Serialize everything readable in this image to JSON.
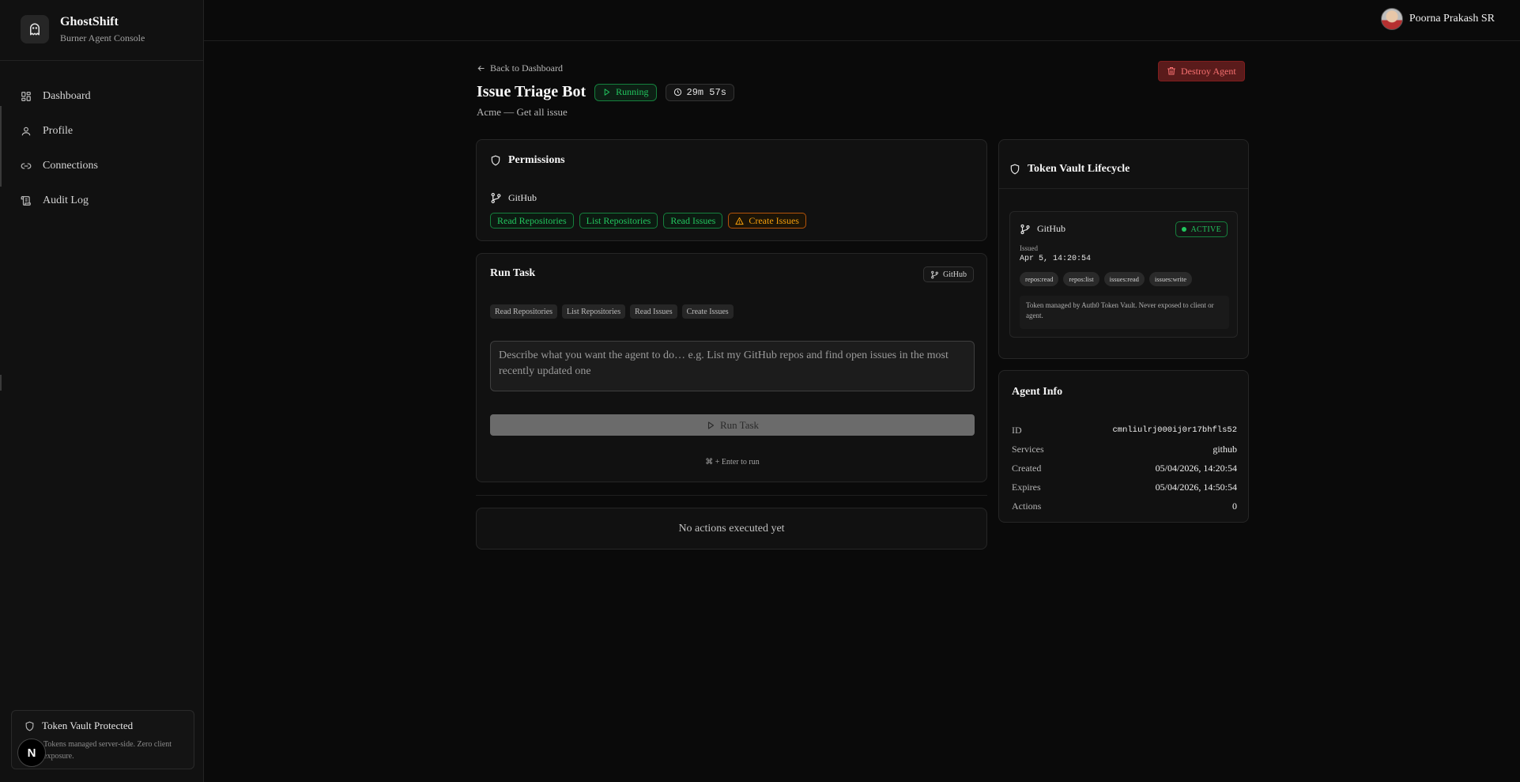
{
  "brand": {
    "name": "GhostShift",
    "subtitle": "Burner Agent Console",
    "logo_icon": "ghost-icon"
  },
  "nav": [
    {
      "label": "Dashboard",
      "icon": "grid-icon"
    },
    {
      "label": "Profile",
      "icon": "user-icon"
    },
    {
      "label": "Connections",
      "icon": "link-icon"
    },
    {
      "label": "Audit Log",
      "icon": "scroll-icon"
    }
  ],
  "sidebar_footer": {
    "title": "Token Vault Protected",
    "description": "Tokens managed server-side. Zero client exposure."
  },
  "badge_letter": "N",
  "user": {
    "name": "Poorna Prakash SR"
  },
  "header": {
    "back_label": "Back to Dashboard",
    "agent_name": "Issue Triage Bot",
    "status": "Running",
    "timer": "29m 57s",
    "subtitle": "Acme — Get all issue",
    "destroy_label": "Destroy Agent"
  },
  "permissions": {
    "title": "Permissions",
    "service": "GitHub",
    "tags": [
      {
        "label": "Read Repositories",
        "kind": "safe"
      },
      {
        "label": "List Repositories",
        "kind": "safe"
      },
      {
        "label": "Read Issues",
        "kind": "safe"
      },
      {
        "label": "Create Issues",
        "kind": "write"
      }
    ]
  },
  "run_task": {
    "title": "Run Task",
    "service_chip": "GitHub",
    "scopes": [
      "Read Repositories",
      "List Repositories",
      "Read Issues",
      "Create Issues"
    ],
    "placeholder": "Describe what you want the agent to do… e.g. List my GitHub repos and find open issues in the most recently updated one",
    "button_label": "Run Task",
    "hint": "⌘ + Enter to run"
  },
  "actions": {
    "empty_text": "No actions executed yet"
  },
  "vault_lifecycle": {
    "title": "Token Vault Lifecycle",
    "service": "GitHub",
    "status": "ACTIVE",
    "issued_label": "Issued",
    "issued_value": "Apr 5, 14:20:54",
    "scopes": [
      "repos:read",
      "repos:list",
      "issues:read",
      "issues:write"
    ],
    "note": "Token managed by Auth0 Token Vault. Never exposed to client or agent."
  },
  "agent_info": {
    "title": "Agent Info",
    "rows": [
      {
        "key": "ID",
        "value": "cmnliulrj000ij0r17bhfls52"
      },
      {
        "key": "Services",
        "value": "github"
      },
      {
        "key": "Created",
        "value": "05/04/2026, 14:20:54"
      },
      {
        "key": "Expires",
        "value": "05/04/2026, 14:50:54"
      },
      {
        "key": "Actions",
        "value": "0"
      }
    ]
  },
  "colors": {
    "accent_green": "#22c55e",
    "warning_amber": "#f59e0b",
    "danger_red": "#f87171",
    "background": "#0a0a0a"
  }
}
